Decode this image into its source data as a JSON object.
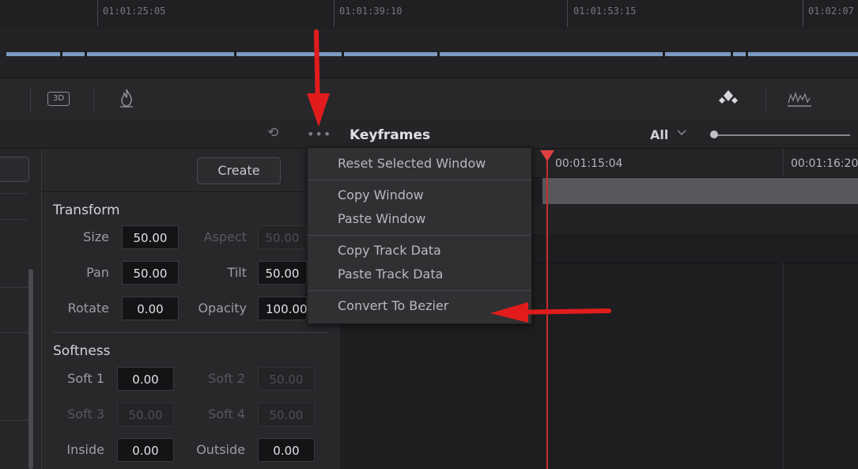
{
  "timeline": {
    "ruler_timecodes": [
      "01:01:25:05",
      "01:01:39:10",
      "01:01:53:15",
      "01:02:07"
    ]
  },
  "toolbar": {
    "icons": [
      "3d-icon",
      "flame-icon",
      "keyframe-diamond-icon",
      "scope-icon"
    ],
    "label_3d": "3D"
  },
  "header": {
    "keyframes_title": "Keyframes",
    "filter_value": "All",
    "dots": "•••",
    "reset_icon_glyph": "⟲"
  },
  "panel": {
    "create_label": "Create",
    "transform_title": "Transform",
    "size_label": "Size",
    "size_value": "50.00",
    "aspect_label": "Aspect",
    "aspect_value": "50.00",
    "pan_label": "Pan",
    "pan_value": "50.00",
    "tilt_label": "Tilt",
    "tilt_value": "50.00",
    "rotate_label": "Rotate",
    "rotate_value": "0.00",
    "opacity_label": "Opacity",
    "opacity_value": "100.00",
    "softness_title": "Softness",
    "soft1_label": "Soft 1",
    "soft1_value": "0.00",
    "soft2_label": "Soft 2",
    "soft2_value": "50.00",
    "soft3_label": "Soft 3",
    "soft3_value": "50.00",
    "soft4_label": "Soft 4",
    "soft4_value": "50.00",
    "inside_label": "Inside",
    "inside_value": "0.00",
    "outside_label": "Outside",
    "outside_value": "0.00"
  },
  "keyframes": {
    "timecode_1": "00:01:15:04",
    "timecode_2": "00:01:16:20"
  },
  "menu": {
    "items": [
      "Reset Selected Window",
      "Copy Window",
      "Paste Window",
      "Copy Track Data",
      "Paste Track Data",
      "Convert To Bezier"
    ]
  },
  "colors": {
    "annotation": "#e21c1c",
    "playhead": "#c2302c",
    "clip": "#7d9ac0"
  }
}
